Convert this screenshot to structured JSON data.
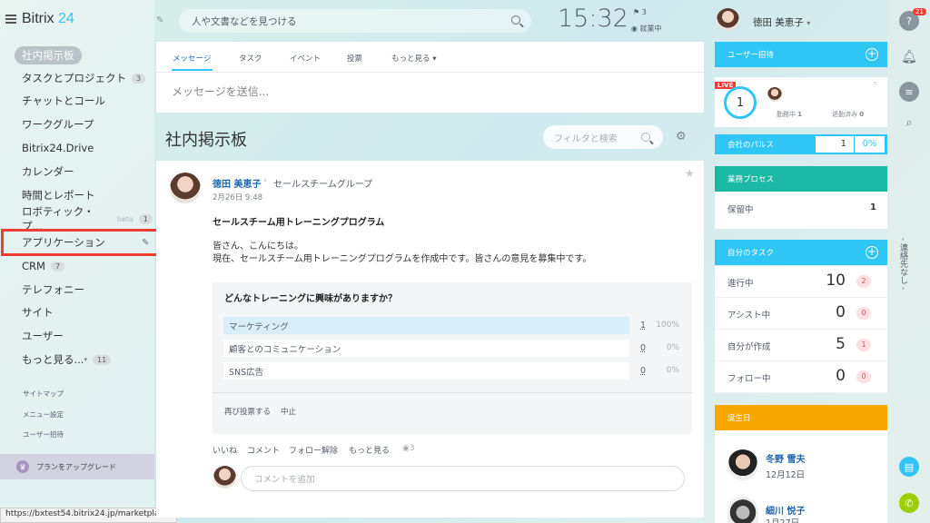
{
  "app": {
    "logo_main": "Bitrix",
    "logo_num": "24"
  },
  "sidebar": {
    "items": [
      {
        "label": "社内掲示板"
      },
      {
        "label": "タスクとプロジェクト",
        "badge": "3"
      },
      {
        "label": "チャットとコール"
      },
      {
        "label": "ワークグループ"
      },
      {
        "label": "Bitrix24.Drive"
      },
      {
        "label": "カレンダー"
      },
      {
        "label": "時間とレポート"
      },
      {
        "label": "ロボティック・プ…",
        "beta": "beta",
        "badge": "1"
      },
      {
        "label": "アプリケーション"
      },
      {
        "label": "CRM",
        "badge": "7"
      },
      {
        "label": "テレフォニー"
      },
      {
        "label": "サイト"
      },
      {
        "label": "ユーザー"
      },
      {
        "label": "もっと見る...",
        "badge": "11"
      }
    ],
    "links": [
      "サイトマップ",
      "メニュー設定",
      "ユーザー招待"
    ],
    "upgrade": "プランをアップグレード",
    "status_url": "https://bxtest54.bitrix24.jp/marketplace/"
  },
  "header": {
    "search_placeholder": "人や文書などを見つける",
    "time": "15:32",
    "flag_count": "3",
    "work_status": "就業中",
    "user_name": "徳田 美恵子"
  },
  "composer": {
    "tabs": [
      "メッセージ",
      "タスク",
      "イベント",
      "投票",
      "もっと見る"
    ],
    "placeholder": "メッセージを送信..."
  },
  "feed": {
    "title": "社内掲示板",
    "filter_placeholder": "フィルタと検索"
  },
  "post": {
    "author": "徳田 美恵子",
    "group": "セールスチームグループ",
    "date": "2月26日 9:48",
    "title": "セールスチーム用トレーニングプログラム",
    "body1": "皆さん、こんにちは。",
    "body2": "現在、セールスチーム用トレーニングプログラムを作成中です。皆さんの意見を募集中です。",
    "vote_question": "どんなトレーニングに興味がありますか？",
    "options": [
      {
        "label": "マーケティング",
        "count": "1",
        "pct": "100%"
      },
      {
        "label": "顧客とのコミュニケーション",
        "count": "0",
        "pct": "0%"
      },
      {
        "label": "SNS広告",
        "count": "0",
        "pct": "0%"
      }
    ],
    "vote_actions": [
      "再び投票する",
      "中止"
    ],
    "actions": [
      "いいね",
      "コメント",
      "フォロー解除",
      "もっと見る"
    ],
    "views": "3",
    "comment_placeholder": "コメントを追加"
  },
  "widgets": {
    "invite": "ユーザー招待",
    "live": "LIVE",
    "online_count": "1",
    "present": "勤務中",
    "present_n": "1",
    "left": "退勤済み",
    "left_n": "0",
    "pulse": "会社のパルス",
    "pulse_n": "1",
    "pulse_pct": "0%",
    "bp": "業務プロセス",
    "bp_pending": "保留中",
    "bp_n": "1",
    "my_tasks": "自分のタスク",
    "tasks": [
      {
        "label": "進行中",
        "n": "10",
        "b": "2"
      },
      {
        "label": "アシスト中",
        "n": "0",
        "b": "0"
      },
      {
        "label": "自分が作成",
        "n": "5",
        "b": "1"
      },
      {
        "label": "フォロー中",
        "n": "0",
        "b": "0"
      }
    ],
    "birthday": "誕生日",
    "bdays": [
      {
        "name": "冬野 雪夫",
        "date": "12月12日"
      },
      {
        "name": "細川 悦子",
        "date": "1月27日"
      }
    ]
  },
  "rightbar": {
    "help_badge": "21",
    "vertical": "- 連絡先なし -"
  }
}
